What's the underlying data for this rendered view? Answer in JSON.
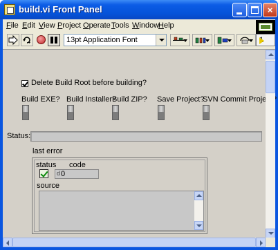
{
  "window": {
    "title": "build.vi Front Panel",
    "buttons": {
      "minimize": "minimize",
      "maximize": "maximize",
      "close": "×"
    }
  },
  "menu": {
    "items": [
      {
        "label": "File"
      },
      {
        "label": "Edit"
      },
      {
        "label": "View"
      },
      {
        "label": "Project"
      },
      {
        "label": "Operate"
      },
      {
        "label": "Tools"
      },
      {
        "label": "Window"
      },
      {
        "label": "Help"
      }
    ]
  },
  "toolbar": {
    "font_select": "13pt Application Font",
    "icons": [
      "run-arrow-icon",
      "run-continuously-icon",
      "abort-icon",
      "pause-icon",
      "align-icon",
      "distribute-icon",
      "resize-icon",
      "reorder-icon"
    ]
  },
  "connector": {
    "number": "1"
  },
  "panel": {
    "delete_build_root": {
      "label": "Delete Build Root before building?",
      "checked": true
    },
    "switches": [
      {
        "label": "Build EXE?"
      },
      {
        "label": "Build Installer?"
      },
      {
        "label": "Build ZIP?"
      },
      {
        "label": "Save Project?"
      },
      {
        "label": "SVN Commit Project?"
      }
    ],
    "status": {
      "label": "Status:",
      "value": ""
    },
    "last_error": {
      "label": "last error",
      "status_label": "status",
      "status_value": true,
      "code_label": "code",
      "code_radix": "d",
      "code_value": "0",
      "source_label": "source",
      "source_value": ""
    }
  },
  "colors": {
    "titlebar": "#0553d9",
    "panel_bg": "#d4d0c8",
    "chrome_bg": "#ece9d8"
  }
}
